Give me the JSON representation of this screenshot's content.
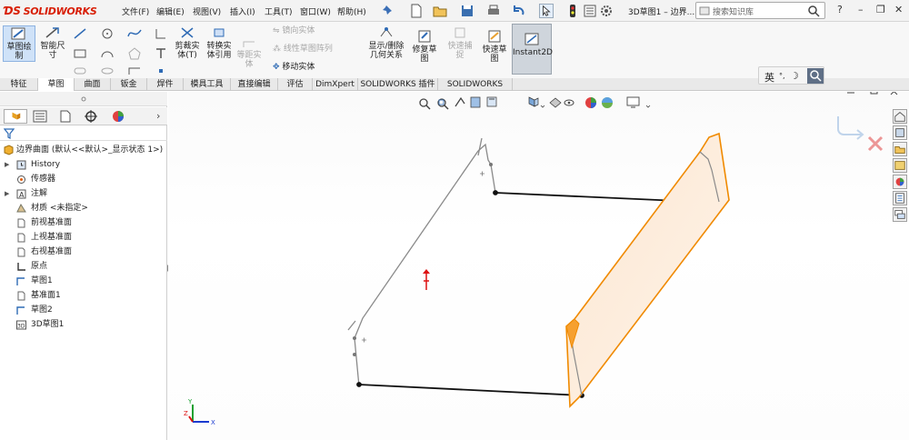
{
  "app": {
    "title": "SOLIDWORKS",
    "doc_title": "3D草图1 – 边界...",
    "search_placeholder": "搜索知识库"
  },
  "menus": [
    "文件(F)",
    "编辑(E)",
    "视图(V)",
    "插入(I)",
    "工具(T)",
    "窗口(W)",
    "帮助(H)"
  ],
  "ribbon": {
    "sketch_draw": "草图绘\n制",
    "smart_dim": "智能尺\n寸",
    "trim": "剪裁实\n体(T)",
    "convert": "转换实\n体引用",
    "offset": "等距实\n体",
    "mirror": "镜向实体",
    "linear_pattern": "线性草图阵列",
    "move": "移动实体",
    "display_relations": "显示/删除\n几何关系",
    "repair": "修复草\n图",
    "quick_snap": "快速捕\n捉",
    "rapid_sketch": "快速草\n图",
    "instant2d": "Instant2D"
  },
  "tabs": [
    "特征",
    "草图",
    "曲面",
    "钣金",
    "焊件",
    "模具工具",
    "直接编辑",
    "评估",
    "DimXpert",
    "SOLIDWORKS 插件",
    "SOLIDWORKS MBD"
  ],
  "active_tab": "草图",
  "tree": {
    "root": "边界曲面  (默认<<默认>_显示状态 1>)",
    "items": [
      {
        "label": "History",
        "arrow": true
      },
      {
        "label": "传感器",
        "arrow": false
      },
      {
        "label": "注解",
        "arrow": true
      },
      {
        "label": "材质 <未指定>",
        "arrow": false
      },
      {
        "label": "前视基准面",
        "arrow": false
      },
      {
        "label": "上视基准面",
        "arrow": false
      },
      {
        "label": "右视基准面",
        "arrow": false
      },
      {
        "label": "原点",
        "arrow": false
      },
      {
        "label": "草图1",
        "arrow": false
      },
      {
        "label": "基准面1",
        "arrow": false
      },
      {
        "label": "草图2",
        "arrow": false
      },
      {
        "label": "3D草图1",
        "arrow": false
      }
    ]
  },
  "ime": {
    "label": "英"
  },
  "triad": {
    "x": "X",
    "y": "Y",
    "z": "Z"
  },
  "colors": {
    "accent": "#f08a00",
    "brand": "#d81e05",
    "selected_surface": "#f7a23c"
  }
}
